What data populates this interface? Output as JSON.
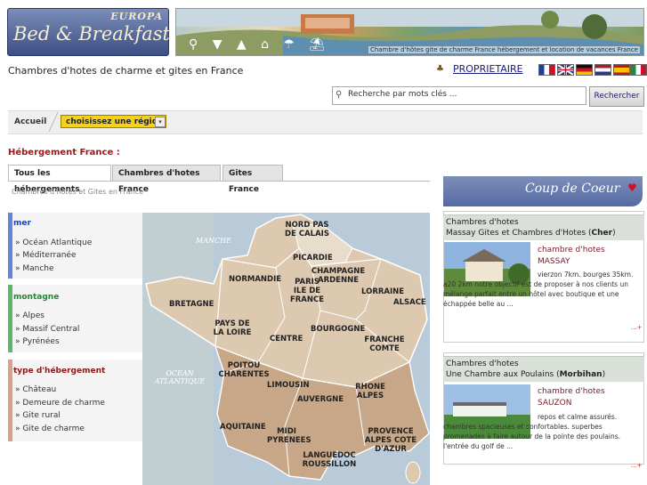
{
  "logo": {
    "europa": "EUROPA",
    "brand": "Bed & Breakfast"
  },
  "banner": {
    "caption": "Chambre d'hôtes gite de charme France hébergement et location de vacances France"
  },
  "header": {
    "tagline": "Chambres d'hotes de charme et gites en France",
    "owner_link": "PROPRIETAIRE"
  },
  "flags": [
    "fr-flag",
    "uk-flag",
    "de-flag",
    "nl-flag",
    "es-flag",
    "it-flag"
  ],
  "search": {
    "placeholder": "Recherche par mots clés ...",
    "button": "Rechercher"
  },
  "breadcrumb": {
    "home": "Accueil",
    "region_select": "choisissez une région"
  },
  "section_title": "Hébergement France :",
  "tabs": [
    "Tous les hébergements",
    "Chambres d'hotes France",
    "Gites France"
  ],
  "subtitle": "Chambres d'hôtes et Gites en France",
  "sidebar": [
    {
      "title": "mer",
      "color": "#1d45b4",
      "items": [
        "Océan Atlantique",
        "Méditerranée",
        "Manche"
      ]
    },
    {
      "title": "montagne",
      "color": "#1d8a2a",
      "items": [
        "Alpes",
        "Massif Central",
        "Pyrénées"
      ]
    },
    {
      "title": "type d'hébergement",
      "color": "#8a1a1a",
      "items": [
        "Château",
        "Demeure de charme",
        "Gite rural",
        "Gite de charme"
      ]
    }
  ],
  "map": {
    "seas": [
      "MANCHE",
      "OCEAN ATLANTIQUE"
    ],
    "regions": [
      "NORD PAS DE CALAIS",
      "PICARDIE",
      "CHAMPAGNE ARDENNE",
      "NORMANDIE",
      "PARIS ILE DE FRANCE",
      "LORRAINE",
      "ALSACE",
      "BRETAGNE",
      "PAYS DE LA LOIRE",
      "CENTRE",
      "BOURGOGNE",
      "FRANCHE COMTE",
      "POITOU CHARENTES",
      "LIMOUSIN",
      "AUVERGNE",
      "RHONE ALPES",
      "AQUITAINE",
      "MIDI PYRENEES",
      "LANGUEDOC ROUSSILLON",
      "PROVENCE ALPES COTE D'AZUR"
    ]
  },
  "coup_de_coeur": {
    "title": "Coup de Coeur"
  },
  "cards": [
    {
      "type": "Chambres d'hotes",
      "name": "Massay Gites et Chambres d'Hotes",
      "dept": "Cher",
      "category": "chambre d'hotes",
      "town": "MASSAY",
      "desc": "vierzon 7km. bourges 35km. a20 2km notre objectif est de proposer à nos clients un mélange parfait entre un hôtel avec boutique et une échappée belle au ...",
      "more": "...+"
    },
    {
      "type": "Chambres d'hotes",
      "name": "Une Chambre aux Poulains",
      "dept": "Morbihan",
      "category": "chambre d'hotes",
      "town": "SAUZON",
      "desc": "repos et calme assurés. chambres spacieuses et confortables. superbes promenades à faire autour de la pointe des poulains. l'entrée du golf de ...",
      "more": "...+"
    }
  ],
  "colors": {
    "accent_red": "#a4161a",
    "highlight_yellow": "#f5d21a",
    "navy": "#1a1a7a"
  }
}
